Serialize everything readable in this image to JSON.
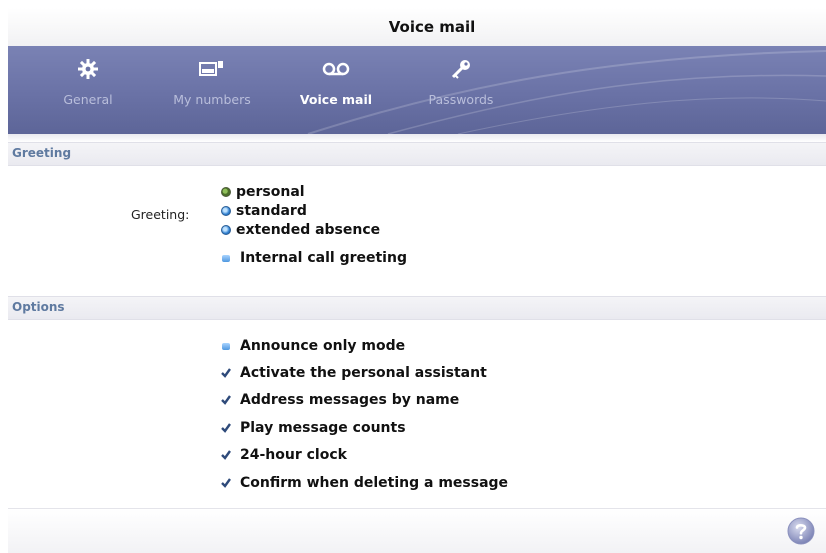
{
  "window": {
    "title": "Voice mail"
  },
  "toolbar": {
    "items": [
      {
        "label": "General",
        "icon": "gear-icon",
        "active": false
      },
      {
        "label": "My numbers",
        "icon": "phone-numbers-icon",
        "active": false
      },
      {
        "label": "Voice mail",
        "icon": "voicemail-icon",
        "active": true
      },
      {
        "label": "Passwords",
        "icon": "key-icon",
        "active": false
      }
    ]
  },
  "greeting_section": {
    "heading": "Greeting",
    "field_label": "Greeting:",
    "options": [
      {
        "label": "personal",
        "selected": true
      },
      {
        "label": "standard",
        "selected": false
      },
      {
        "label": "extended absence",
        "selected": false
      }
    ],
    "internal_call": {
      "label": "Internal call greeting",
      "checked": false
    }
  },
  "options_section": {
    "heading": "Options",
    "items": [
      {
        "label": "Announce only mode",
        "checked": false
      },
      {
        "label": "Activate the personal assistant",
        "checked": true
      },
      {
        "label": "Address messages by name",
        "checked": true
      },
      {
        "label": "Play message counts",
        "checked": true
      },
      {
        "label": "24-hour clock",
        "checked": true
      },
      {
        "label": "Confirm when deleting a message",
        "checked": true
      }
    ]
  },
  "footer": {
    "help_icon": "help-icon"
  },
  "colors": {
    "toolbar_bg": "#6a72a6",
    "section_heading": "#5f7aa0",
    "radio_selected": "#6f9a3c",
    "radio_unselected": "#2f7fd0",
    "checkmark": "#2e4a7a"
  }
}
